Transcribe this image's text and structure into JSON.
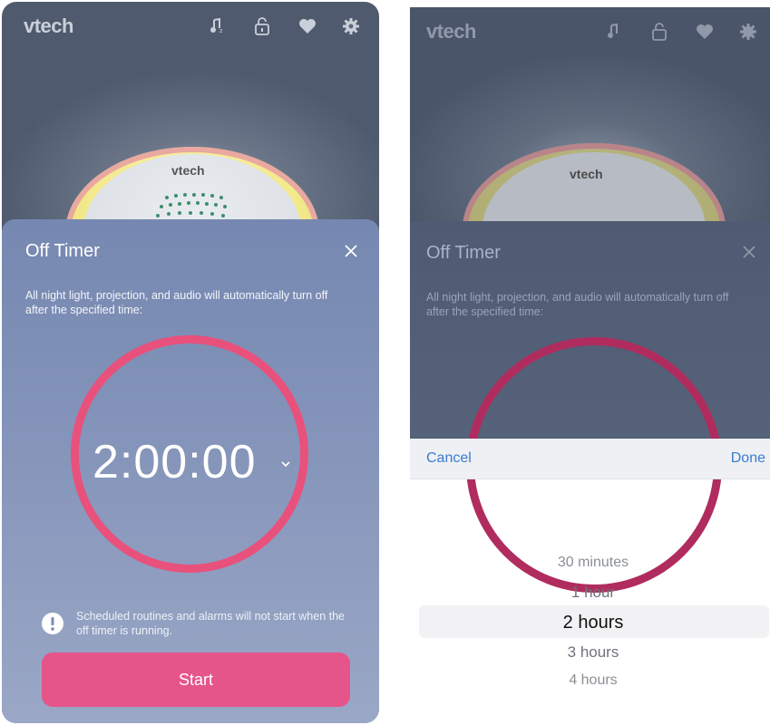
{
  "left": {
    "logo": "vtech",
    "device_logo": "vtech",
    "sheet": {
      "title": "Off Timer",
      "description": "All night light, projection, and audio will automatically turn off after the specified time:",
      "timer_value": "2:00:00",
      "warning": "Scheduled routines and alarms will not start when the off timer is running.",
      "start_label": "Start"
    }
  },
  "right": {
    "logo": "vtech",
    "device_logo": "vtech",
    "sheet": {
      "title": "Off Timer",
      "description": "All night light, projection, and audio will automatically turn off after the specified time:"
    },
    "picker": {
      "cancel_label": "Cancel",
      "done_label": "Done",
      "options": [
        "30 minutes",
        "1 hour",
        "2 hours",
        "3 hours",
        "4 hours"
      ],
      "selected": "2 hours"
    }
  },
  "colors": {
    "accent": "#e5558a",
    "ring": "#e8517c",
    "link": "#3a7bd5"
  },
  "icons": [
    "music-note-icon",
    "lock-icon",
    "heart-icon",
    "gear-icon",
    "close-icon",
    "chevron-down-icon",
    "exclamation-icon"
  ]
}
